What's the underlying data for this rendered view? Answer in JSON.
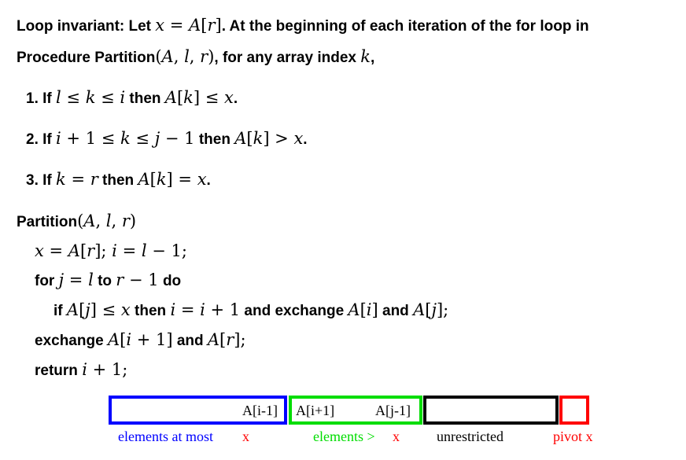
{
  "invariant": {
    "intro_a": "Loop invariant: Let",
    "intro_b": ". At the beginning of each iteration of the for loop in",
    "intro_c": "Procedure Partition",
    "intro_d": ", for any array index",
    "intro_e": ",",
    "items": [
      {
        "num": "1.",
        "if": "If",
        "then": "then",
        "end": "."
      },
      {
        "num": "2.",
        "if": "If",
        "then": "then",
        "end": "."
      },
      {
        "num": "3.",
        "if": "If",
        "then": "then",
        "end": "."
      }
    ]
  },
  "procedure": {
    "name": "Partition",
    "for_kw": "for",
    "to_kw": "to",
    "do_kw": "do",
    "if_kw": "if",
    "then_kw": "then",
    "and_exchange": "and exchange",
    "and_kw": "and",
    "exchange_kw": "exchange",
    "return_kw": "return"
  },
  "diagram": {
    "colors": {
      "blue": "#0000ff",
      "green": "#00dd00",
      "black": "#000000",
      "red": "#ff0000"
    },
    "labels": {
      "a_i_minus_1": "A[i-1]",
      "a_i_plus_1": "A[i+1]",
      "a_j_minus_1": "A[j-1]"
    },
    "legend": {
      "elements_at_most": "elements at most",
      "x1": "x",
      "elements_gt": "elements >",
      "x2": "x",
      "unrestricted": "unrestricted",
      "pivot": "pivot x"
    }
  }
}
